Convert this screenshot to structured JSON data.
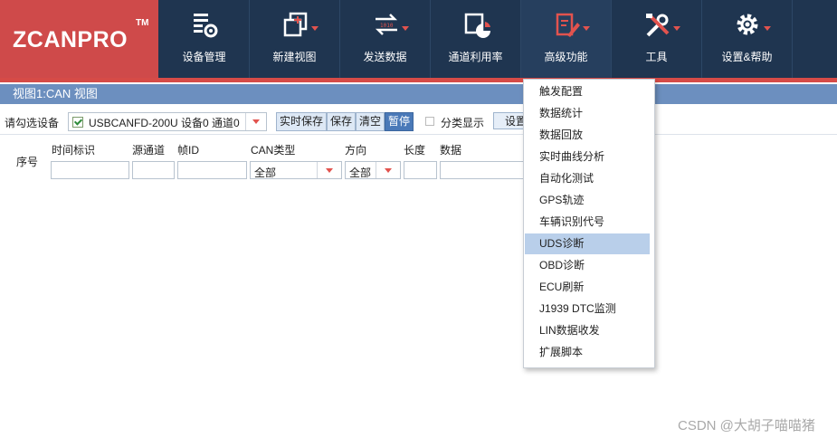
{
  "brand": {
    "logo_text": "ZCANPRO",
    "tm": "TM"
  },
  "nav": [
    {
      "label": "设备管理",
      "icon": "device-manage-icon"
    },
    {
      "label": "新建视图",
      "icon": "new-view-icon"
    },
    {
      "label": "发送数据",
      "icon": "send-data-icon"
    },
    {
      "label": "通道利用率",
      "icon": "channel-usage-icon"
    },
    {
      "label": "高级功能",
      "icon": "advanced-icon"
    },
    {
      "label": "工具",
      "icon": "tools-icon"
    },
    {
      "label": "设置&帮助",
      "icon": "settings-icon"
    }
  ],
  "view": {
    "title": "视图1:CAN 视图"
  },
  "toolbar": {
    "device_label": "请勾选设备",
    "device_value": "USBCANFD-200U 设备0 通道0",
    "realtime_save": "实时保存",
    "save": "保存",
    "clear": "清空",
    "pause": "暂停",
    "category_display": "分类显示",
    "settings": "设置"
  },
  "table": {
    "headers": {
      "seq": "序号",
      "time": "时间标识",
      "source": "源通道",
      "frame_id": "帧ID",
      "can_type": "CAN类型",
      "direction": "方向",
      "length": "长度",
      "data": "数据"
    },
    "filters": {
      "can_type": "全部",
      "direction": "全部"
    }
  },
  "menu": {
    "items": [
      "触发配置",
      "数据统计",
      "数据回放",
      "实时曲线分析",
      "自动化测试",
      "GPS轨迹",
      "车辆识别代号",
      "UDS诊断",
      "OBD诊断",
      "ECU刷新",
      "J1939 DTC监测",
      "LIN数据收发",
      "扩展脚本"
    ],
    "highlighted": "UDS诊断"
  },
  "watermark": "CSDN @大胡子喵喵猪",
  "colors": {
    "logo_bg": "#cf4a4a",
    "topbar_bg": "#1f3550",
    "accent_red": "#d64b47",
    "title_bar": "#6c8fbf",
    "highlight": "#b9cfea"
  }
}
